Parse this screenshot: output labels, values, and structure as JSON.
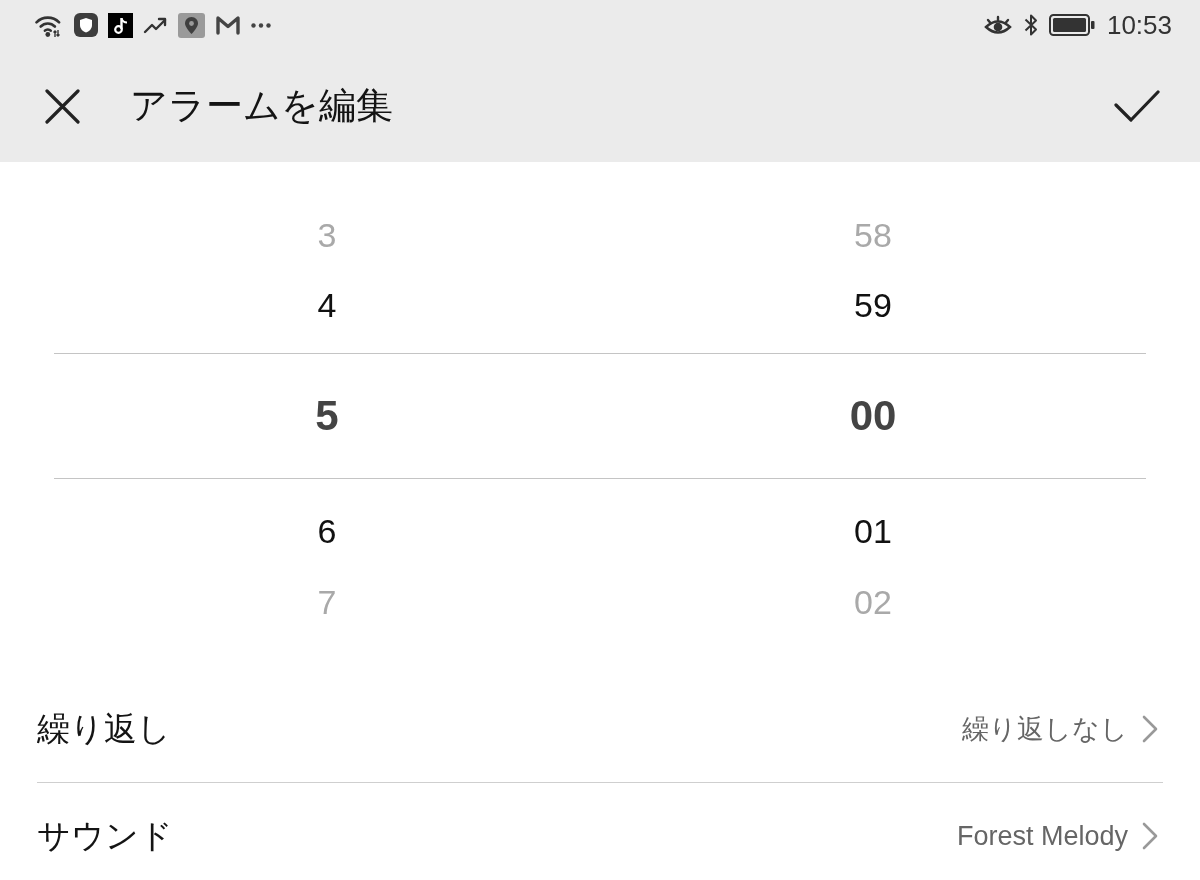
{
  "status_bar": {
    "time": "10:53"
  },
  "toolbar": {
    "title": "アラームを編集"
  },
  "picker": {
    "columns": [
      {
        "items": [
          {
            "label": "3",
            "selected": false
          },
          {
            "label": "4",
            "selected": false
          },
          {
            "label": "5",
            "selected": true
          },
          {
            "label": "6",
            "selected": false
          },
          {
            "label": "7",
            "selected": false
          }
        ]
      },
      {
        "items": [
          {
            "label": "58",
            "selected": false
          },
          {
            "label": "59",
            "selected": false
          },
          {
            "label": "00",
            "selected": true
          },
          {
            "label": "01",
            "selected": false
          },
          {
            "label": "02",
            "selected": false
          }
        ]
      }
    ]
  },
  "settings": [
    {
      "label": "繰り返し",
      "value": "繰り返しなし"
    },
    {
      "label": "サウンド",
      "value": "Forest Melody"
    }
  ]
}
